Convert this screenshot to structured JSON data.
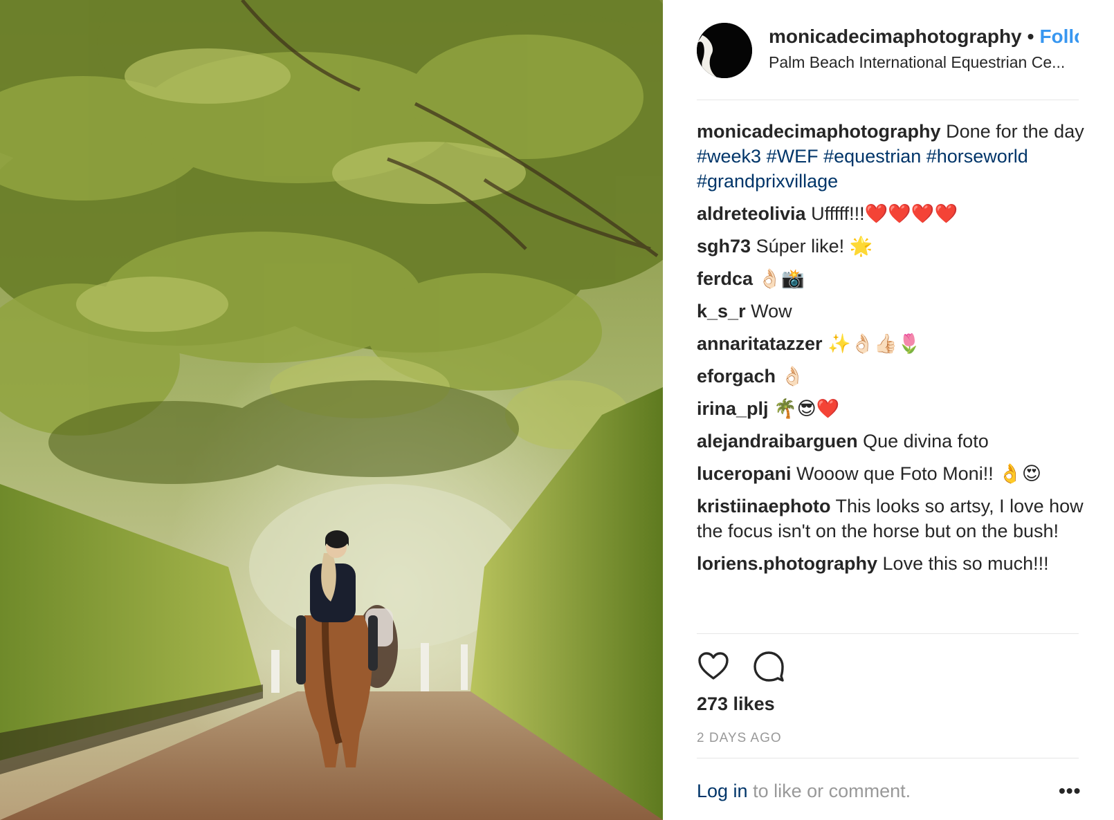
{
  "post": {
    "username": "monicadecimaphotography",
    "separator": "•",
    "follow_label": "Follo",
    "location": "Palm Beach International Equestrian Ce...",
    "caption": {
      "user": "monicadecimaphotography",
      "text": "Done for the day",
      "hashtags": [
        "#week3",
        "#WEF",
        "#equestrian",
        "#horseworld",
        "#grandprixvillage"
      ]
    }
  },
  "comments": [
    {
      "user": "aldreteolivia",
      "text": "Ufffff!!!❤️❤️❤️❤️"
    },
    {
      "user": "sgh73",
      "text": "Súper like! 🌟"
    },
    {
      "user": "ferdca",
      "text": "👌🏻📸"
    },
    {
      "user": "k_s_r",
      "text": "Wow"
    },
    {
      "user": "annaritatazzer",
      "text": "✨👌🏻👍🏻🌷"
    },
    {
      "user": "eforgach",
      "text": "👌🏻"
    },
    {
      "user": "irina_plj",
      "text": "🌴😎❤️"
    },
    {
      "user": "alejandraibarguen",
      "text": "Que divina foto"
    },
    {
      "user": "luceropani",
      "text": "Wooow que Foto Moni!! 👌😍"
    },
    {
      "user": "kristiinaephoto",
      "text": "This looks so artsy, I love how the focus isn't on the horse but on the bush!"
    },
    {
      "user": "loriens.photography",
      "text": "Love this so much!!!"
    }
  ],
  "icons": {
    "like": "heart-icon",
    "comment": "comment-bubble-icon",
    "more": "more-options-icon"
  },
  "likes_text": "273 likes",
  "timestamp": "2 DAYS AGO",
  "footer": {
    "login_label": "Log in",
    "rest": "to like or comment."
  },
  "more_label": "•••",
  "colors": {
    "link": "#003569",
    "follow": "#3897f0",
    "muted": "#999999",
    "text": "#262626"
  }
}
